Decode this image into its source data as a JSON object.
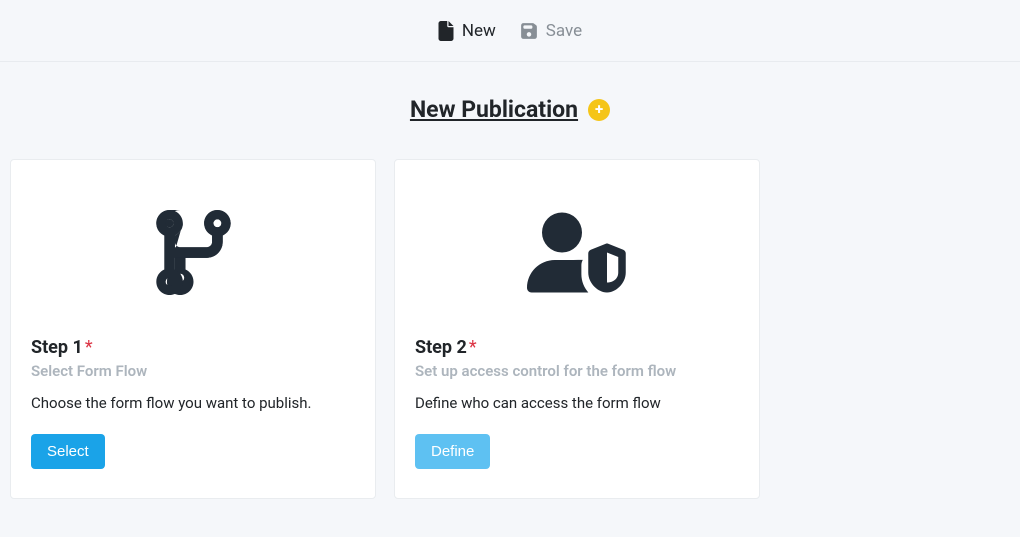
{
  "toolbar": {
    "new_label": "New",
    "save_label": "Save"
  },
  "page": {
    "title": "New Publication"
  },
  "steps": [
    {
      "label": "Step 1",
      "required": "*",
      "subtitle": "Select Form Flow",
      "description": "Choose the form flow you want to publish.",
      "button": "Select"
    },
    {
      "label": "Step 2",
      "required": "*",
      "subtitle": "Set up access control for the form flow",
      "description": "Define who can access the form flow",
      "button": "Define"
    }
  ]
}
